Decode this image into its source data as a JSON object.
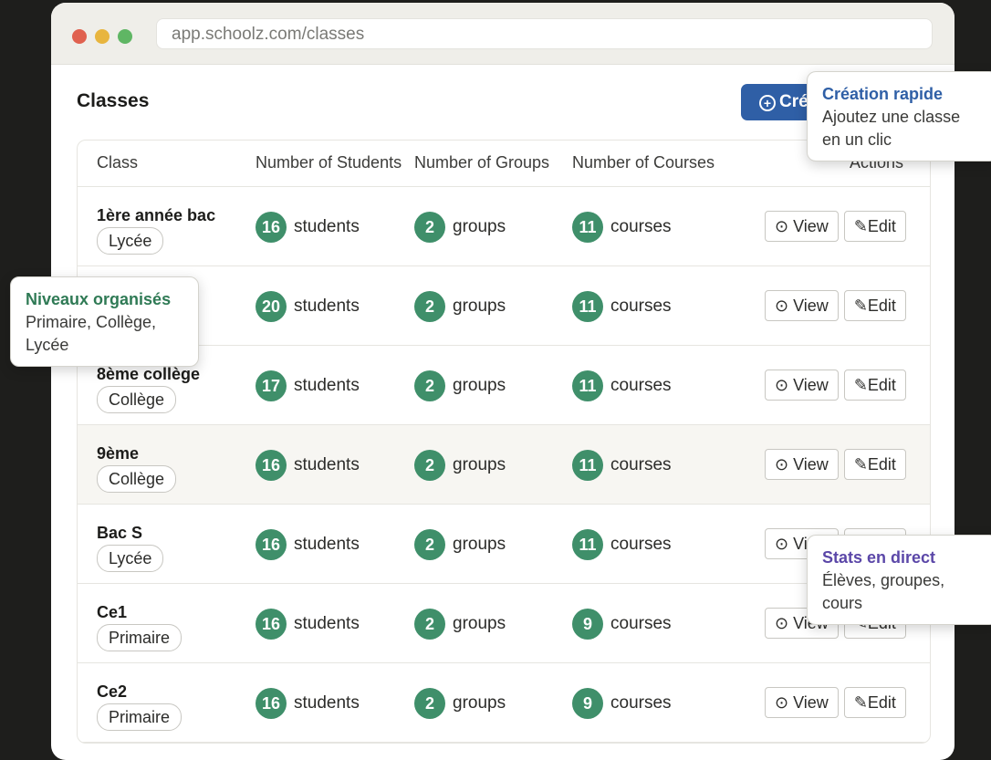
{
  "browser": {
    "url": "app.schoolz.com/classes"
  },
  "page": {
    "title": "Classes",
    "create_label": "Cré"
  },
  "table": {
    "headers": [
      "Class",
      "Number of Students",
      "Number of Groups",
      "Number of Courses",
      "Actions"
    ],
    "view_label": "View",
    "edit_label": "Edit",
    "students_unit": "students",
    "groups_unit": "groups",
    "courses_unit": "courses",
    "rows": [
      {
        "name": "1ère année bac",
        "level": "Lycée",
        "students": "16",
        "groups": "2",
        "courses": "11"
      },
      {
        "name": "",
        "level": "",
        "students": "20",
        "groups": "2",
        "courses": "11"
      },
      {
        "name": "8ème collège",
        "level": "Collège",
        "students": "17",
        "groups": "2",
        "courses": "11"
      },
      {
        "name": "9ème",
        "level": "Collège",
        "students": "16",
        "groups": "2",
        "courses": "11"
      },
      {
        "name": "Bac S",
        "level": "Lycée",
        "students": "16",
        "groups": "2",
        "courses": "11"
      },
      {
        "name": "Ce1",
        "level": "Primaire",
        "students": "16",
        "groups": "2",
        "courses": "9"
      },
      {
        "name": "Ce2",
        "level": "Primaire",
        "students": "16",
        "groups": "2",
        "courses": "9"
      }
    ]
  },
  "tooltips": {
    "levels": {
      "title": "Niveaux organisés",
      "body": "Primaire, Collège, Lycée"
    },
    "quick_create": {
      "title": "Création rapide",
      "body": "Ajoutez une classe en un clic"
    },
    "stats": {
      "title": "Stats en direct",
      "body": "Élèves, groupes, cours"
    }
  },
  "colors": {
    "accent": "#2f5fa6",
    "badge": "#3f8f6a",
    "levels_title": "#2f7a55",
    "stats_title": "#5b47a8"
  }
}
